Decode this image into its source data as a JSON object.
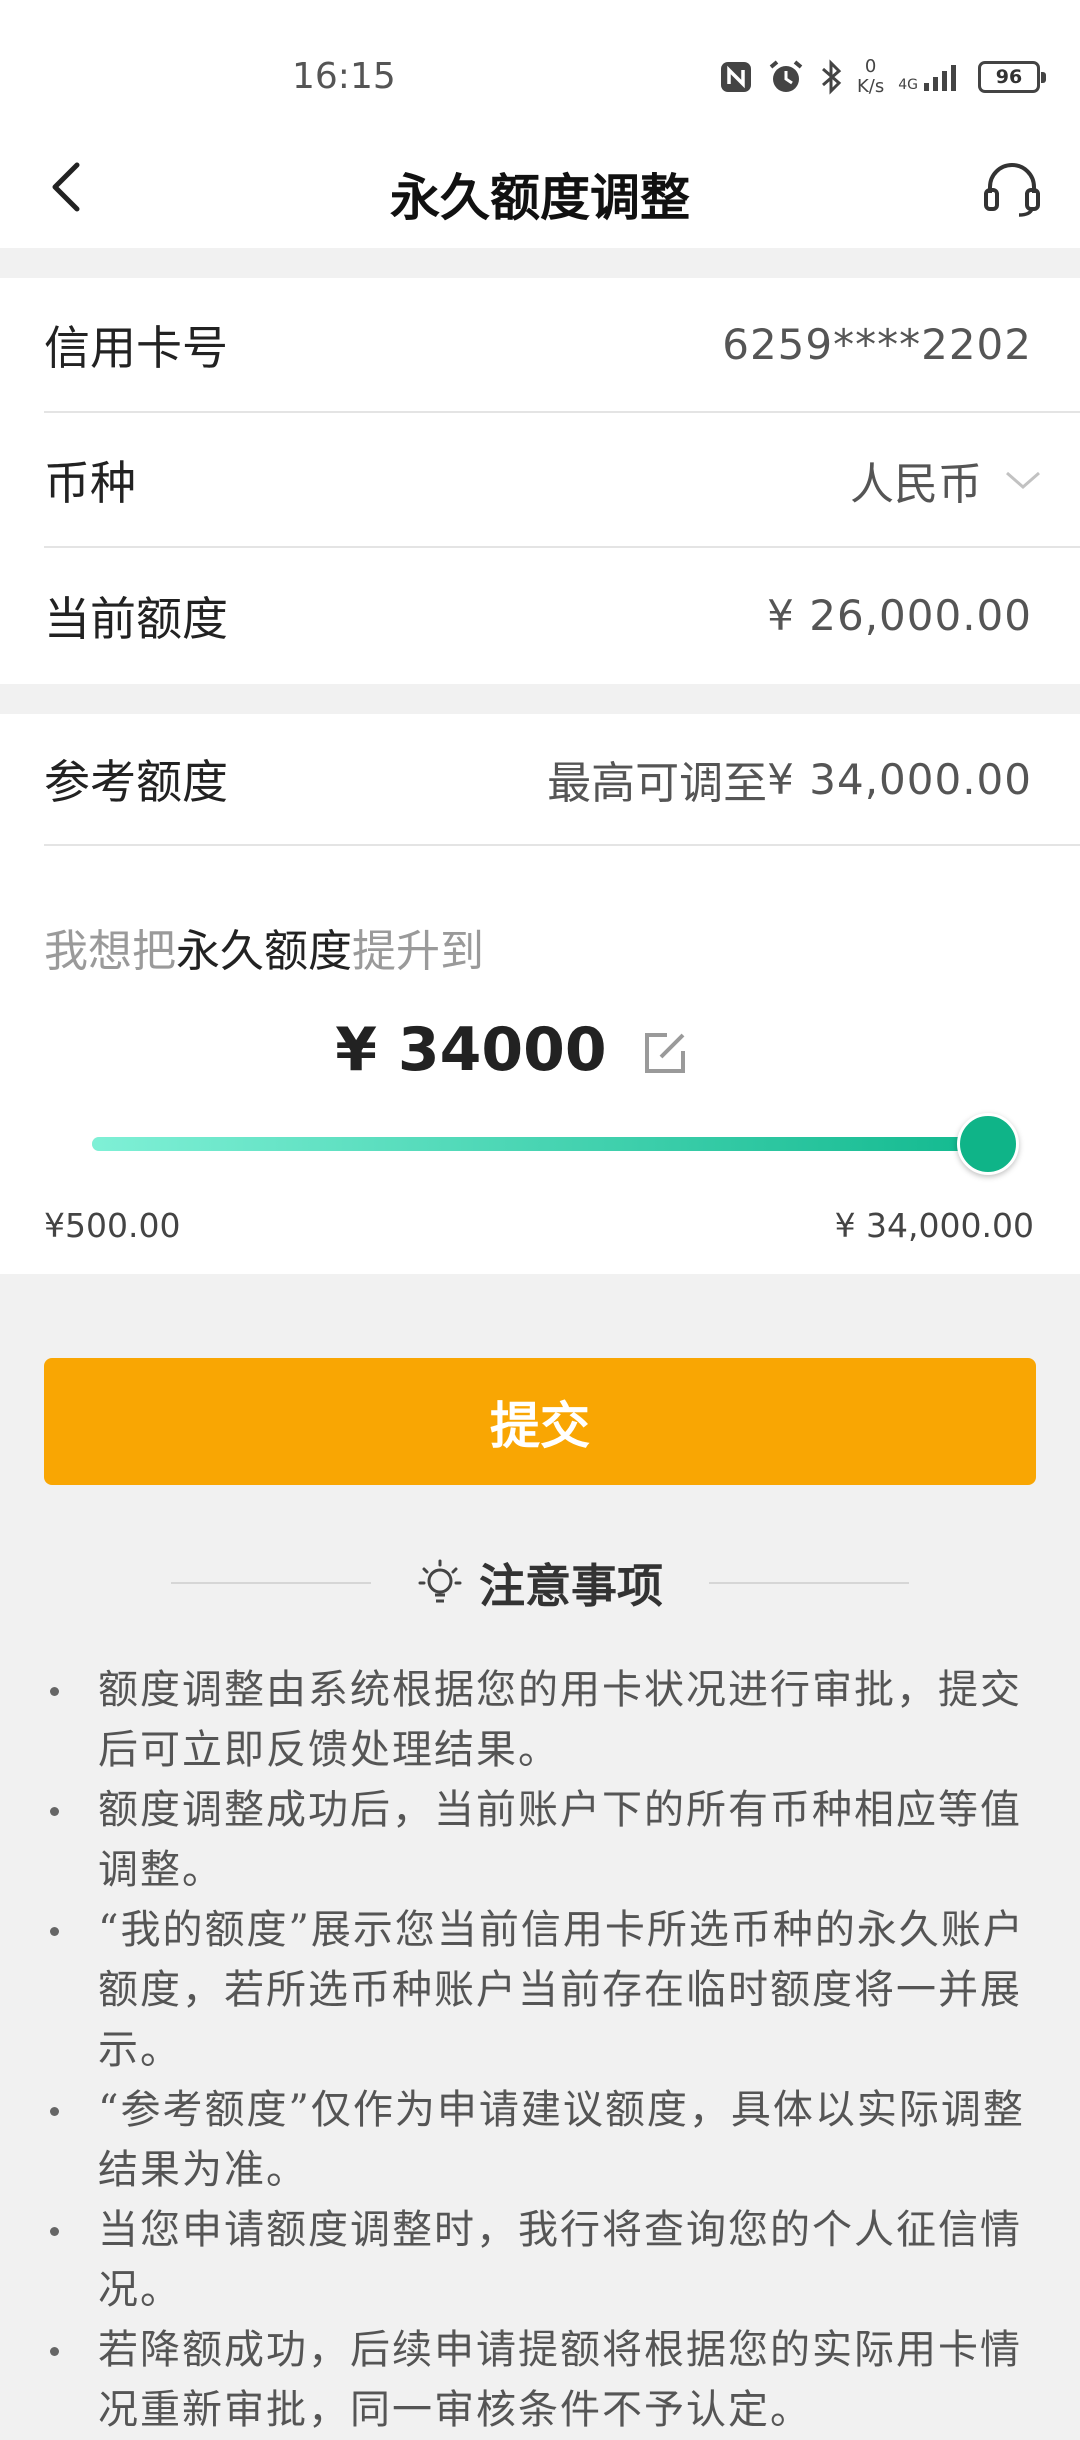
{
  "status_bar": {
    "time": "16:15",
    "speed_value": "0",
    "speed_unit": "K/s",
    "network": "4G",
    "battery": "96",
    "icons": [
      "nfc-icon",
      "alarm-icon",
      "bluetooth-icon",
      "signal-icon",
      "battery-icon"
    ]
  },
  "header": {
    "title": "永久额度调整",
    "back_icon": "chevron-left-icon",
    "service_icon": "headset-icon"
  },
  "card_info": {
    "rows": [
      {
        "label": "信用卡号",
        "value": "6259****2202"
      },
      {
        "label": "币种",
        "value": "人民币"
      },
      {
        "label": "当前额度",
        "value": "¥ 26,000.00"
      }
    ]
  },
  "adjust": {
    "reference_label": "参考额度",
    "reference_prefix": "最高可调至",
    "reference_amount": "¥ 34,000.00",
    "prompt_pre": "我想把",
    "prompt_highlight": "永久额度",
    "prompt_post": "提升到",
    "amount": "¥ 34000",
    "slider_min": 500,
    "slider_max": 34000,
    "slider_value": 34000,
    "range_min_label": "¥500.00",
    "range_max_label": "¥ 34,000.00"
  },
  "submit_label": "提交",
  "notice": {
    "title": "注意事项",
    "items": [
      "额度调整由系统根据您的用卡状况进行审批，提交后可立即反馈处理结果。",
      "额度调整成功后，当前账户下的所有币种相应等值调整。",
      "“我的额度”展示您当前信用卡所选币种的永久账户额度，若所选币种账户当前存在临时额度将一并展示。",
      "“参考额度”仅作为申请建议额度，具体以实际调整结果为准。",
      "当您申请额度调整时，我行将查询您的个人征信情况。",
      "若降额成功，后续申请提额将根据您的实际用卡情况重新审批，同一审核条件不予认定。"
    ]
  },
  "colors": {
    "accent": "#f9a603",
    "slider_start": "#7ff0d6",
    "slider_end": "#12b98f"
  }
}
